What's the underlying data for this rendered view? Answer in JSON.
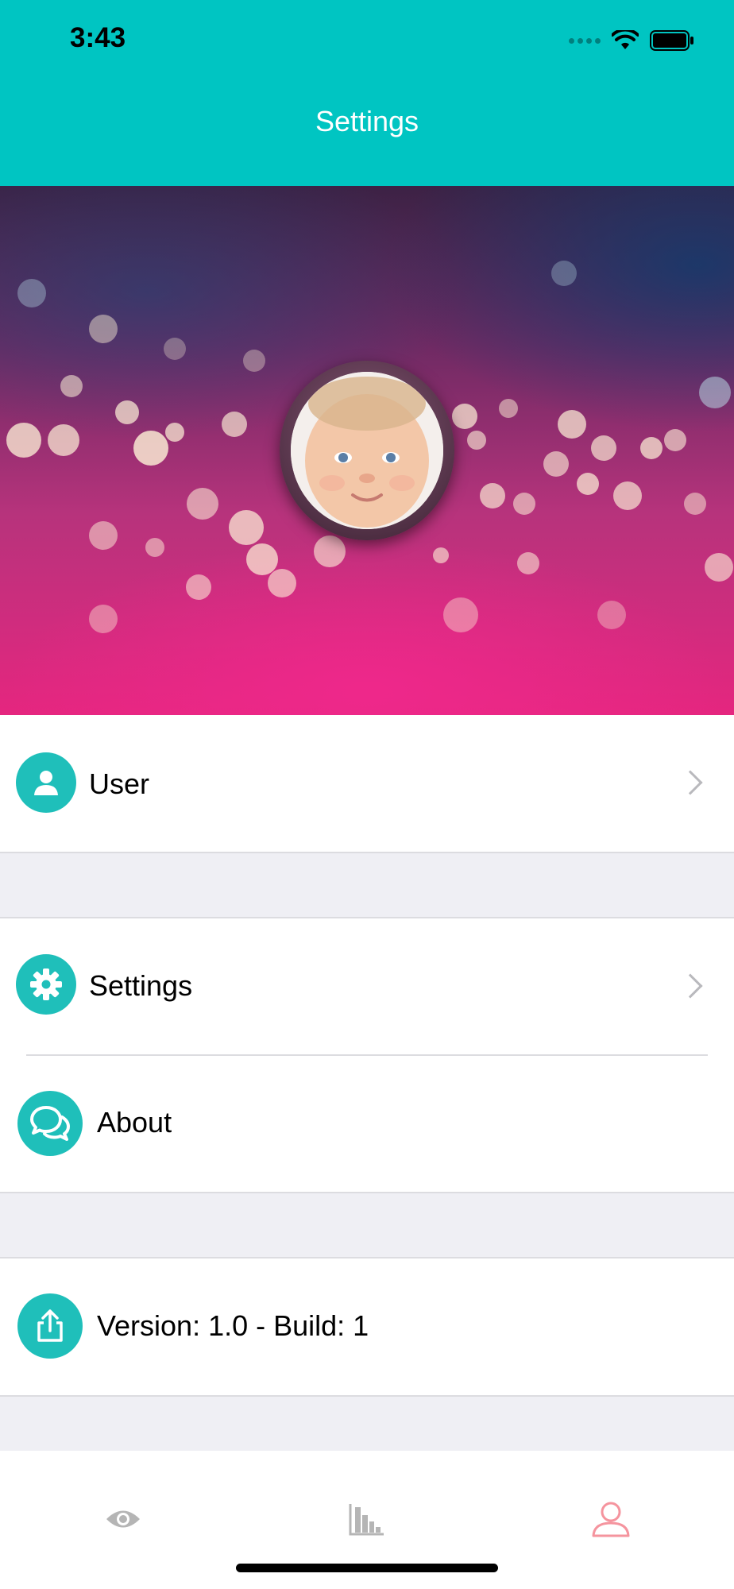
{
  "status_bar": {
    "time": "3:43"
  },
  "nav": {
    "title": "Settings"
  },
  "hero": {
    "avatar_icon": "baby-photo"
  },
  "menu": {
    "user_label": "User",
    "settings_label": "Settings",
    "about_label": "About",
    "version_label": "Version: 1.0 - Build: 1"
  },
  "tabs": [
    {
      "icon": "eye-icon"
    },
    {
      "icon": "bar-chart-icon"
    },
    {
      "icon": "person-icon",
      "selected": true
    }
  ],
  "colors": {
    "header": "#00c5c2",
    "icon_bg": "#1fbfba",
    "active_tab": "#f5949e",
    "inactive_tab": "#b5b5b5"
  }
}
